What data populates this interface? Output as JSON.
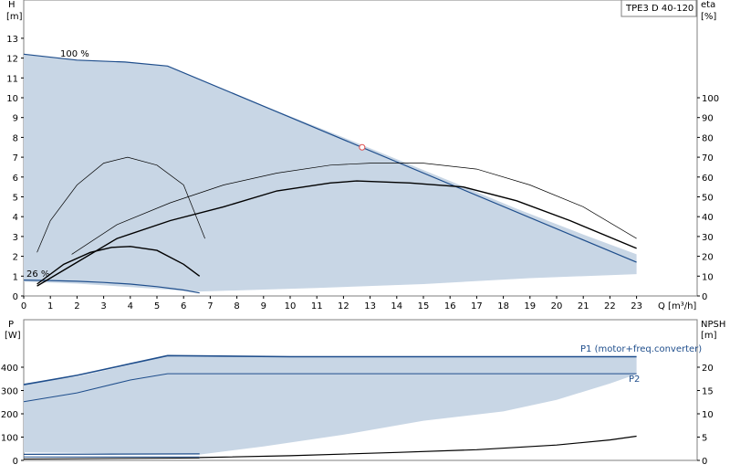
{
  "chart_data": {
    "title": "TPE3 D 40-120",
    "colors": {
      "band": "#c8d6e5",
      "curve": "#1f4e8c",
      "line": "#000000",
      "frame": "#7f7f7f",
      "marker": "#e05050"
    },
    "top": {
      "type": "line",
      "xlabel": "Q [m³/h]",
      "ylabel": {
        "name": "H",
        "unit": "[m]"
      },
      "y2label": {
        "name": "eta",
        "unit": "[%]"
      },
      "xlim": [
        0,
        24
      ],
      "ylim": [
        0,
        14.7
      ],
      "y2_per_unit": 10,
      "xticks": [
        0,
        1,
        2,
        3,
        4,
        5,
        6,
        7,
        8,
        9,
        10,
        11,
        12,
        13,
        14,
        15,
        16,
        17,
        18,
        19,
        20,
        21,
        22,
        23
      ],
      "yticks": [
        0,
        1,
        2,
        3,
        4,
        5,
        6,
        7,
        8,
        9,
        10,
        11,
        12,
        13
      ],
      "y2ticks": [
        0,
        10,
        20,
        30,
        40,
        50,
        60,
        70,
        80,
        90,
        100
      ],
      "annotations": {
        "max_speed": "100 %",
        "min_speed": "26 %"
      },
      "band": [
        [
          0,
          12.2
        ],
        [
          2,
          11.9
        ],
        [
          3.8,
          11.8
        ],
        [
          5.4,
          11.6
        ],
        [
          6.5,
          11.0
        ],
        [
          9,
          9.6
        ],
        [
          12,
          8.0
        ],
        [
          14,
          6.9
        ],
        [
          16,
          5.8
        ],
        [
          18.5,
          4.4
        ],
        [
          21,
          3.1
        ],
        [
          23,
          2.1
        ],
        [
          23,
          1.1
        ],
        [
          19,
          0.9
        ],
        [
          15,
          0.6
        ],
        [
          11,
          0.4
        ],
        [
          6.5,
          0.22
        ],
        [
          4,
          0.45
        ],
        [
          2,
          0.62
        ],
        [
          0,
          0.72
        ]
      ],
      "series": [
        {
          "role": "max-curve",
          "values": [
            [
              0,
              12.2
            ],
            [
              2,
              11.9
            ],
            [
              3.8,
              11.8
            ],
            [
              5.4,
              11.6
            ],
            [
              23,
              1.7
            ]
          ]
        },
        {
          "role": "min-curve",
          "values": [
            [
              0,
              0.8
            ],
            [
              1,
              0.78
            ],
            [
              2,
              0.74
            ],
            [
              3,
              0.68
            ],
            [
              4,
              0.6
            ],
            [
              5,
              0.47
            ],
            [
              6,
              0.3
            ],
            [
              6.6,
              0.15
            ]
          ]
        },
        {
          "role": "eta-max",
          "values": [
            [
              1.8,
              2.1
            ],
            [
              3.5,
              3.6
            ],
            [
              5.5,
              4.7
            ],
            [
              7.5,
              5.6
            ],
            [
              9.5,
              6.2
            ],
            [
              11.5,
              6.6
            ],
            [
              13,
              6.7
            ],
            [
              15,
              6.7
            ],
            [
              17,
              6.4
            ],
            [
              19,
              5.6
            ],
            [
              21,
              4.5
            ],
            [
              23,
              2.9
            ]
          ]
        },
        {
          "role": "eta-bold",
          "values": [
            [
              0.5,
              0.5
            ],
            [
              2,
              1.7
            ],
            [
              3.5,
              2.9
            ],
            [
              5.5,
              3.8
            ],
            [
              7.5,
              4.5
            ],
            [
              9.5,
              5.3
            ],
            [
              11.5,
              5.7
            ],
            [
              12.5,
              5.8
            ],
            [
              14.5,
              5.7
            ],
            [
              16.5,
              5.5
            ],
            [
              18.5,
              4.8
            ],
            [
              20.5,
              3.8
            ],
            [
              23,
              2.4
            ]
          ]
        },
        {
          "role": "eta-mid-thin",
          "values": [
            [
              0.5,
              2.2
            ],
            [
              1,
              3.8
            ],
            [
              2,
              5.6
            ],
            [
              3,
              6.7
            ],
            [
              3.9,
              7.0
            ],
            [
              5,
              6.6
            ],
            [
              6,
              5.6
            ],
            [
              6.8,
              2.9
            ]
          ]
        },
        {
          "role": "eta-mid-bold",
          "values": [
            [
              0.5,
              0.6
            ],
            [
              1.5,
              1.6
            ],
            [
              2.5,
              2.2
            ],
            [
              3.3,
              2.45
            ],
            [
              4,
              2.5
            ],
            [
              5,
              2.3
            ],
            [
              6,
              1.6
            ],
            [
              6.6,
              1.0
            ]
          ]
        }
      ],
      "marker": [
        12.7,
        7.5
      ]
    },
    "bottom": {
      "type": "line",
      "ylabel": {
        "name": "P",
        "unit": "[W]"
      },
      "y2label": {
        "name": "NPSH",
        "unit": "[m]"
      },
      "xlim": [
        0,
        24
      ],
      "ylim": [
        0,
        475
      ],
      "y2_per_unit": 20,
      "yticks": [
        0,
        100,
        200,
        300,
        400
      ],
      "y2ticks": [
        0,
        5,
        10,
        15,
        20
      ],
      "legend": {
        "p1": "P1 (motor+freq.converter)",
        "p2": "P2"
      },
      "band": [
        [
          0,
          330
        ],
        [
          2,
          360
        ],
        [
          4,
          410
        ],
        [
          5.4,
          450
        ],
        [
          8,
          448
        ],
        [
          23,
          445
        ],
        [
          23,
          370
        ],
        [
          22,
          330
        ],
        [
          20,
          260
        ],
        [
          18,
          210
        ],
        [
          15,
          170
        ],
        [
          12,
          110
        ],
        [
          9,
          60
        ],
        [
          6.6,
          25
        ],
        [
          4,
          28
        ],
        [
          2,
          32
        ],
        [
          0,
          35
        ]
      ],
      "series": [
        {
          "name": "P1 (motor+freq.converter)",
          "values": [
            [
              0,
              325
            ],
            [
              2,
              365
            ],
            [
              4,
              415
            ],
            [
              5.4,
              450
            ],
            [
              10,
              445
            ],
            [
              23,
              445
            ]
          ]
        },
        {
          "name": "P2",
          "values": [
            [
              0,
              252
            ],
            [
              2,
              290
            ],
            [
              4,
              345
            ],
            [
              5.4,
              372
            ],
            [
              23,
              372
            ]
          ]
        },
        {
          "role": "npsh",
          "values": [
            [
              6.6,
              0.6
            ],
            [
              10,
              1.0
            ],
            [
              14,
              1.7
            ],
            [
              17,
              2.3
            ],
            [
              20,
              3.3
            ],
            [
              22,
              4.4
            ],
            [
              23,
              5.2
            ]
          ]
        },
        {
          "role": "p1-min",
          "values": [
            [
              0,
              26
            ],
            [
              6.6,
              28
            ]
          ]
        },
        {
          "role": "p2-min",
          "values": [
            [
              0,
              15
            ],
            [
              6.6,
              15
            ]
          ]
        },
        {
          "role": "p-min-low",
          "values": [
            [
              0,
              6
            ],
            [
              6.6,
              10
            ]
          ]
        }
      ]
    }
  }
}
